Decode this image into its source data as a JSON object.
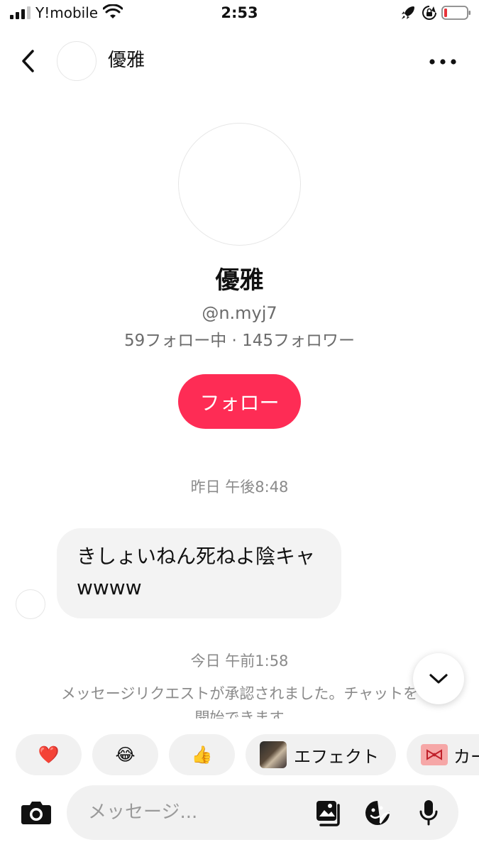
{
  "status_bar": {
    "carrier": "Y!mobile",
    "time": "2:53",
    "icons": [
      "signal-icon",
      "wifi-icon",
      "rocket-icon",
      "rotation-lock-icon",
      "battery-low-icon"
    ]
  },
  "header": {
    "name": "優雅",
    "icons": [
      "back-arrow-icon",
      "more-dots-icon"
    ]
  },
  "profile": {
    "name": "優雅",
    "handle": "@n.myj7",
    "stats": "59フォロー中 · 145フォロワー",
    "follow_label": "フォロー"
  },
  "chat": {
    "timestamp_1": "昨日 午後8:48",
    "message_1": "きしょいねん死ねよ陰キャwwww",
    "timestamp_2": "今日 午前1:58",
    "system_message": "メッセージリクエストが承認されました。チャットを開始できます"
  },
  "quick_reactions": {
    "heart": "❤️",
    "laugh": "😂",
    "thumbs_up": "👍",
    "effect_label": "エフェクト",
    "card_label": "カー"
  },
  "composer": {
    "placeholder": "メッセージ..."
  },
  "colors": {
    "accent": "#fe2c55",
    "bubble": "#f3f3f3",
    "muted_text": "#8a8a8a"
  }
}
